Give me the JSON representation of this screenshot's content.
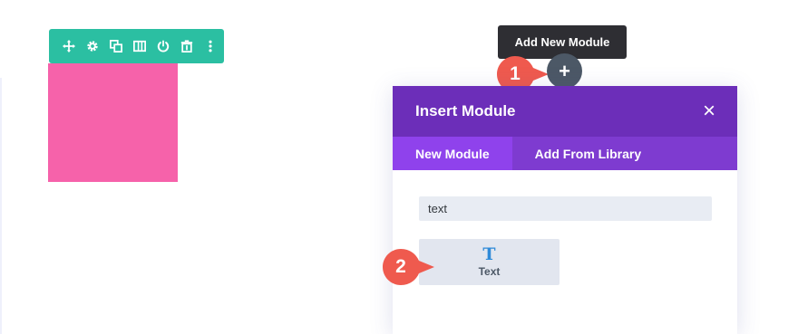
{
  "toolbar": {
    "icons": [
      "move-icon",
      "gear-icon",
      "duplicate-icon",
      "columns-icon",
      "power-icon",
      "trash-icon",
      "more-icon"
    ],
    "color": "#2bbfa2"
  },
  "block": {
    "color": "#f662aa"
  },
  "tooltip": {
    "text": "Add New Module"
  },
  "add_button": {
    "label": "+"
  },
  "steps": [
    {
      "number": "1"
    },
    {
      "number": "2"
    }
  ],
  "modal": {
    "title": "Insert Module",
    "close_label": "×",
    "tabs": [
      {
        "label": "New Module",
        "active": true
      },
      {
        "label": "Add From Library",
        "active": false
      }
    ],
    "search": {
      "value": "text",
      "placeholder": ""
    },
    "results": [
      {
        "icon": "text-icon",
        "glyph": "T",
        "label": "Text"
      }
    ]
  },
  "colors": {
    "header": "#6c2eb9",
    "tabs": "#7e3bd0",
    "active_tab": "#8f42ec",
    "step_marker": "#ef5a4e"
  }
}
